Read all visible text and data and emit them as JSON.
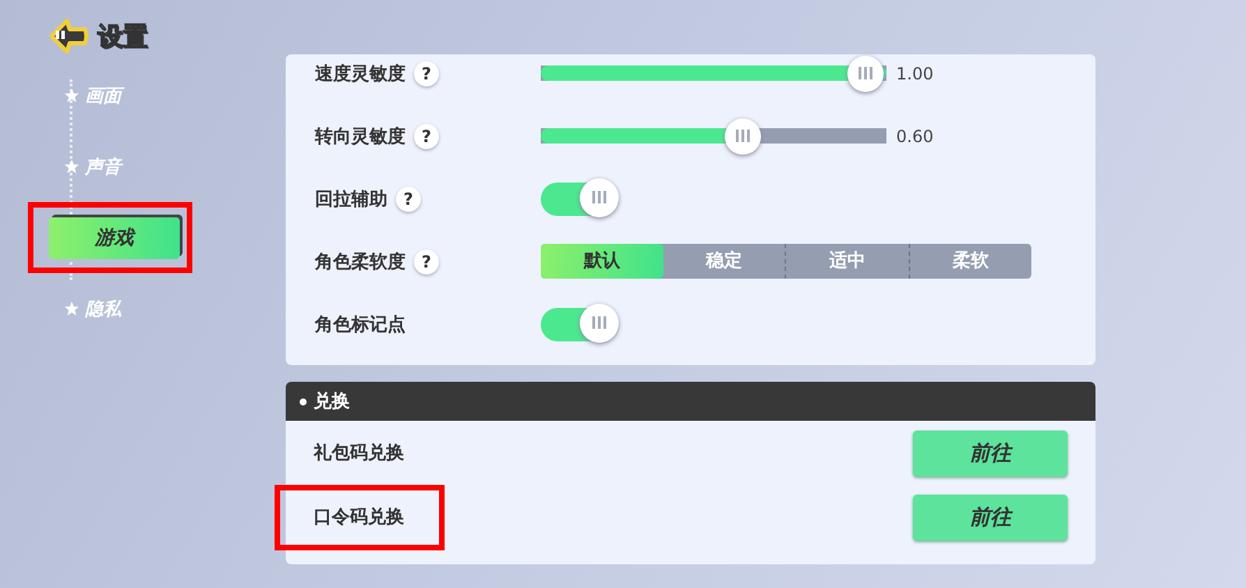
{
  "header": {
    "title": "设置"
  },
  "sidebar": {
    "items": [
      {
        "label": "画面",
        "selected": false,
        "highlighted": false
      },
      {
        "label": "声音",
        "selected": false,
        "highlighted": false
      },
      {
        "label": "游戏",
        "selected": true,
        "highlighted": true
      },
      {
        "label": "隐私",
        "selected": false,
        "highlighted": false
      }
    ]
  },
  "settings": [
    {
      "kind": "slider",
      "label": "速度灵敏度",
      "help": "?",
      "level": 1.0,
      "reading": "1.00"
    },
    {
      "kind": "slider",
      "label": "转向灵敏度",
      "help": "?",
      "level": 0.6,
      "reading": "0.60"
    },
    {
      "kind": "toggle",
      "label": "回拉辅助",
      "help": "?",
      "on": true
    },
    {
      "kind": "segmented",
      "label": "角色柔软度",
      "help": "?",
      "options": [
        {
          "label": "默认",
          "selected": true
        },
        {
          "label": "稳定",
          "selected": false
        },
        {
          "label": "适中",
          "selected": false
        },
        {
          "label": "柔软",
          "selected": false
        }
      ]
    },
    {
      "kind": "toggle",
      "label": "角色标记点",
      "on": true
    }
  ],
  "redeem": {
    "title": "兑换",
    "rows": [
      {
        "label": "礼包码兑换",
        "button": "前往",
        "highlighted": false
      },
      {
        "label": "口令码兑换",
        "button": "前往",
        "highlighted": true
      }
    ]
  }
}
